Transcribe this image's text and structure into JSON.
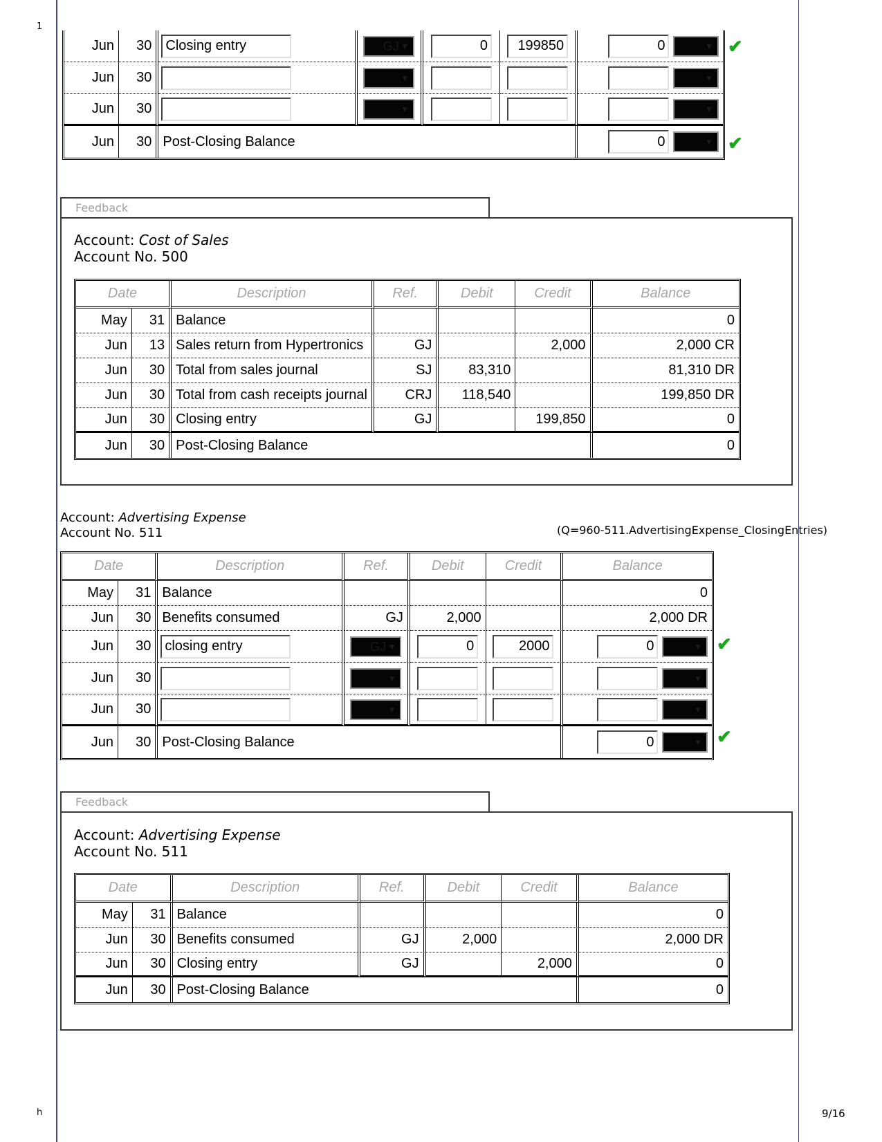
{
  "margin": {
    "line_num": "1",
    "bottom_mark": "h",
    "page": "9/16"
  },
  "question_id": "(Q=960-511.AdvertisingExpense_ClosingEntries)",
  "headers": {
    "date": "Date",
    "description": "Description",
    "ref": "Ref.",
    "debit": "Debit",
    "credit": "Credit",
    "balance": "Balance"
  },
  "top_entry": {
    "rows": [
      {
        "month": "Jun",
        "day": "30",
        "description": "Closing entry",
        "ref": "GJ",
        "debit": "0",
        "credit": "199850",
        "balance": "0",
        "balance_type": "",
        "correct": true
      },
      {
        "month": "Jun",
        "day": "30",
        "description": "",
        "ref": "",
        "debit": "",
        "credit": "",
        "balance": "",
        "balance_type": ""
      },
      {
        "month": "Jun",
        "day": "30",
        "description": "",
        "ref": "",
        "debit": "",
        "credit": "",
        "balance": "",
        "balance_type": ""
      }
    ],
    "post_closing": {
      "month": "Jun",
      "day": "30",
      "description": "Post-Closing Balance",
      "balance": "0",
      "balance_type": "",
      "correct": true
    }
  },
  "feedback1": {
    "tab_label": "Feedback",
    "account_label": "Account:",
    "account_name": "Cost of Sales",
    "account_no": "Account No. 500",
    "rows": [
      {
        "month": "May",
        "day": "31",
        "description": "Balance",
        "ref": "",
        "debit": "",
        "credit": "",
        "balance": "0"
      },
      {
        "month": "Jun",
        "day": "13",
        "description": "Sales return from Hypertronics",
        "ref": "GJ",
        "debit": "",
        "credit": "2,000",
        "balance": "2,000 CR"
      },
      {
        "month": "Jun",
        "day": "30",
        "description": "Total from sales journal",
        "ref": "SJ",
        "debit": "83,310",
        "credit": "",
        "balance": "81,310 DR"
      },
      {
        "month": "Jun",
        "day": "30",
        "description": "Total from cash receipts journal",
        "ref": "CRJ",
        "debit": "118,540",
        "credit": "",
        "balance": "199,850 DR"
      },
      {
        "month": "Jun",
        "day": "30",
        "description": "Closing entry",
        "ref": "GJ",
        "debit": "",
        "credit": "199,850",
        "balance": "0"
      }
    ],
    "post_closing": {
      "month": "Jun",
      "day": "30",
      "description": "Post-Closing Balance",
      "balance": "0"
    }
  },
  "advertising": {
    "account_label": "Account:",
    "account_name": "Advertising Expense",
    "account_no": "Account No. 511",
    "fixed_rows": [
      {
        "month": "May",
        "day": "31",
        "description": "Balance",
        "ref": "",
        "debit": "",
        "credit": "",
        "balance": "0"
      },
      {
        "month": "Jun",
        "day": "30",
        "description": "Benefits consumed",
        "ref": "GJ",
        "debit": "2,000",
        "credit": "",
        "balance": "2,000 DR"
      }
    ],
    "input_rows": [
      {
        "month": "Jun",
        "day": "30",
        "description": "closing entry",
        "ref": "GJ",
        "debit": "0",
        "credit": "2000",
        "balance": "0",
        "balance_type": "",
        "correct": true
      },
      {
        "month": "Jun",
        "day": "30",
        "description": "",
        "ref": "",
        "debit": "",
        "credit": "",
        "balance": "",
        "balance_type": ""
      },
      {
        "month": "Jun",
        "day": "30",
        "description": "",
        "ref": "",
        "debit": "",
        "credit": "",
        "balance": "",
        "balance_type": ""
      }
    ],
    "post_closing": {
      "month": "Jun",
      "day": "30",
      "description": "Post-Closing Balance",
      "balance": "0",
      "balance_type": "",
      "correct": true
    }
  },
  "feedback2": {
    "tab_label": "Feedback",
    "account_label": "Account:",
    "account_name": "Advertising Expense",
    "account_no": "Account No. 511",
    "rows": [
      {
        "month": "May",
        "day": "31",
        "description": "Balance",
        "ref": "",
        "debit": "",
        "credit": "",
        "balance": "0"
      },
      {
        "month": "Jun",
        "day": "30",
        "description": "Benefits consumed",
        "ref": "GJ",
        "debit": "2,000",
        "credit": "",
        "balance": "2,000 DR"
      },
      {
        "month": "Jun",
        "day": "30",
        "description": "Closing entry",
        "ref": "GJ",
        "debit": "",
        "credit": "2,000",
        "balance": "0"
      }
    ],
    "post_closing": {
      "month": "Jun",
      "day": "30",
      "description": "Post-Closing Balance",
      "balance": "0"
    }
  },
  "colors": {
    "check": "#1aa81a",
    "header_text": "#a6a6a6",
    "page_line": "#4b4a7c"
  }
}
